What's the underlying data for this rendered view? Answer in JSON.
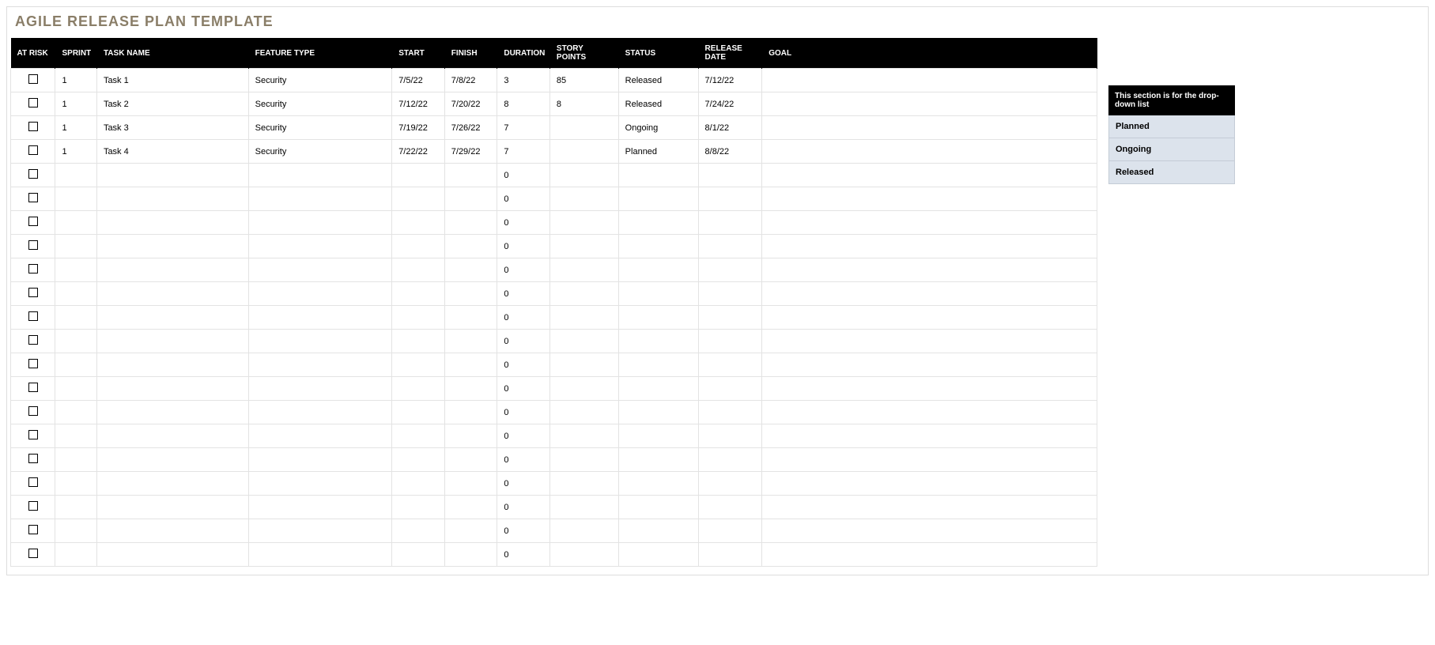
{
  "title": "AGILE RELEASE PLAN TEMPLATE",
  "headers": {
    "at_risk": "AT RISK",
    "sprint": "SPRINT",
    "task_name": "TASK NAME",
    "feature_type": "FEATURE TYPE",
    "start": "START",
    "finish": "FINISH",
    "duration": "DURATION",
    "story_points": "STORY POINTS",
    "status": "STATUS",
    "release_date": "RELEASE DATE",
    "goal": "GOAL"
  },
  "rows": [
    {
      "sprint": "1",
      "task": "Task 1",
      "feature": "Security",
      "start": "7/5/22",
      "finish": "7/8/22",
      "duration": "3",
      "story": "85",
      "status": "Released",
      "release": "7/12/22",
      "goal": ""
    },
    {
      "sprint": "1",
      "task": "Task 2",
      "feature": "Security",
      "start": "7/12/22",
      "finish": "7/20/22",
      "duration": "8",
      "story": "8",
      "status": "Released",
      "release": "7/24/22",
      "goal": ""
    },
    {
      "sprint": "1",
      "task": "Task 3",
      "feature": "Security",
      "start": "7/19/22",
      "finish": "7/26/22",
      "duration": "7",
      "story": "",
      "status": "Ongoing",
      "release": "8/1/22",
      "goal": ""
    },
    {
      "sprint": "1",
      "task": "Task 4",
      "feature": "Security",
      "start": "7/22/22",
      "finish": "7/29/22",
      "duration": "7",
      "story": "",
      "status": "Planned",
      "release": "8/8/22",
      "goal": ""
    },
    {
      "sprint": "",
      "task": "",
      "feature": "",
      "start": "",
      "finish": "",
      "duration": "0",
      "story": "",
      "status": "",
      "release": "",
      "goal": ""
    },
    {
      "sprint": "",
      "task": "",
      "feature": "",
      "start": "",
      "finish": "",
      "duration": "0",
      "story": "",
      "status": "",
      "release": "",
      "goal": ""
    },
    {
      "sprint": "",
      "task": "",
      "feature": "",
      "start": "",
      "finish": "",
      "duration": "0",
      "story": "",
      "status": "",
      "release": "",
      "goal": ""
    },
    {
      "sprint": "",
      "task": "",
      "feature": "",
      "start": "",
      "finish": "",
      "duration": "0",
      "story": "",
      "status": "",
      "release": "",
      "goal": ""
    },
    {
      "sprint": "",
      "task": "",
      "feature": "",
      "start": "",
      "finish": "",
      "duration": "0",
      "story": "",
      "status": "",
      "release": "",
      "goal": ""
    },
    {
      "sprint": "",
      "task": "",
      "feature": "",
      "start": "",
      "finish": "",
      "duration": "0",
      "story": "",
      "status": "",
      "release": "",
      "goal": ""
    },
    {
      "sprint": "",
      "task": "",
      "feature": "",
      "start": "",
      "finish": "",
      "duration": "0",
      "story": "",
      "status": "",
      "release": "",
      "goal": ""
    },
    {
      "sprint": "",
      "task": "",
      "feature": "",
      "start": "",
      "finish": "",
      "duration": "0",
      "story": "",
      "status": "",
      "release": "",
      "goal": ""
    },
    {
      "sprint": "",
      "task": "",
      "feature": "",
      "start": "",
      "finish": "",
      "duration": "0",
      "story": "",
      "status": "",
      "release": "",
      "goal": ""
    },
    {
      "sprint": "",
      "task": "",
      "feature": "",
      "start": "",
      "finish": "",
      "duration": "0",
      "story": "",
      "status": "",
      "release": "",
      "goal": ""
    },
    {
      "sprint": "",
      "task": "",
      "feature": "",
      "start": "",
      "finish": "",
      "duration": "0",
      "story": "",
      "status": "",
      "release": "",
      "goal": ""
    },
    {
      "sprint": "",
      "task": "",
      "feature": "",
      "start": "",
      "finish": "",
      "duration": "0",
      "story": "",
      "status": "",
      "release": "",
      "goal": ""
    },
    {
      "sprint": "",
      "task": "",
      "feature": "",
      "start": "",
      "finish": "",
      "duration": "0",
      "story": "",
      "status": "",
      "release": "",
      "goal": ""
    },
    {
      "sprint": "",
      "task": "",
      "feature": "",
      "start": "",
      "finish": "",
      "duration": "0",
      "story": "",
      "status": "",
      "release": "",
      "goal": ""
    },
    {
      "sprint": "",
      "task": "",
      "feature": "",
      "start": "",
      "finish": "",
      "duration": "0",
      "story": "",
      "status": "",
      "release": "",
      "goal": ""
    },
    {
      "sprint": "",
      "task": "",
      "feature": "",
      "start": "",
      "finish": "",
      "duration": "0",
      "story": "",
      "status": "",
      "release": "",
      "goal": ""
    },
    {
      "sprint": "",
      "task": "",
      "feature": "",
      "start": "",
      "finish": "",
      "duration": "0",
      "story": "",
      "status": "",
      "release": "",
      "goal": ""
    }
  ],
  "dropdown": {
    "header": "This section is for the drop-down list",
    "items": [
      "Planned",
      "Ongoing",
      "Released"
    ]
  }
}
